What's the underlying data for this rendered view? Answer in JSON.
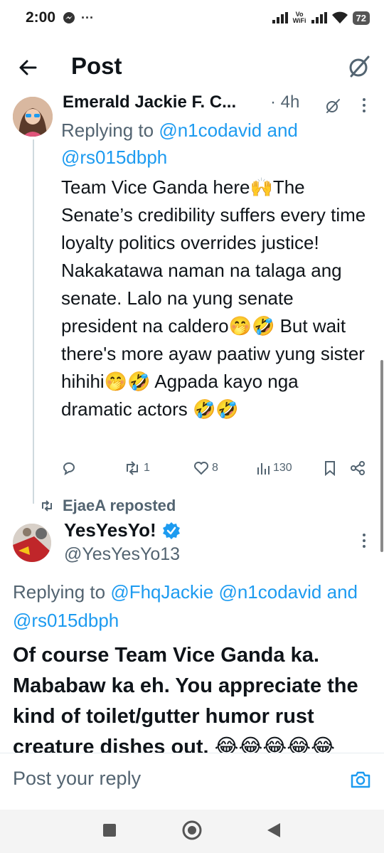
{
  "status_bar": {
    "time": "2:00",
    "extra": "···",
    "vowifi_line1": "Vo",
    "vowifi_line2": "WiFi",
    "battery": "72"
  },
  "header": {
    "title": "Post"
  },
  "tweet1": {
    "author": "Emerald Jackie F. C...",
    "time": "· 4h",
    "replying_prefix": "Replying to",
    "mention1": "@n1codavid",
    "replying_and": "and",
    "mention2": "@rs015dbph",
    "body": "Team Vice Ganda here🙌The Senate’s credibility suffers every time loyalty politics overrides justice! Nakakatawa naman na talaga ang senate. Lalo na yung senate president na caldero🤭🤣 But wait there's more ayaw paatiw yung sister hihihi🤭🤣 Agpada kayo nga dramatic actors 🤣🤣",
    "retweets": "1",
    "likes": "8",
    "views": "130"
  },
  "repost": {
    "label": "EjaeA reposted"
  },
  "tweet2": {
    "author": "YesYesYo!",
    "handle": "@YesYesYo13",
    "replying_prefix": "Replying to",
    "mention1": "@FhqJackie",
    "mention2": "@n1codavid",
    "replying_and": "and",
    "mention3": "@rs015dbph",
    "body": "Of course Team Vice Ganda ka. Mababaw ka eh. You appreciate the kind of toilet/gutter humor rust creature dishes out. 😂😂😂😂😂"
  },
  "reply_bar": {
    "placeholder": "Post your reply"
  },
  "colors": {
    "accent": "#1d9bf0",
    "secondary_text": "#536471",
    "verified": "#1d9bf0"
  },
  "icons": [
    "back-arrow-icon",
    "grok-icon",
    "more-icon",
    "reply-icon",
    "retweet-icon",
    "heart-icon",
    "views-icon",
    "bookmark-icon",
    "share-icon",
    "repost-icon",
    "verified-badge-icon",
    "camera-icon",
    "nav-recents-icon",
    "nav-home-icon",
    "nav-back-icon"
  ]
}
